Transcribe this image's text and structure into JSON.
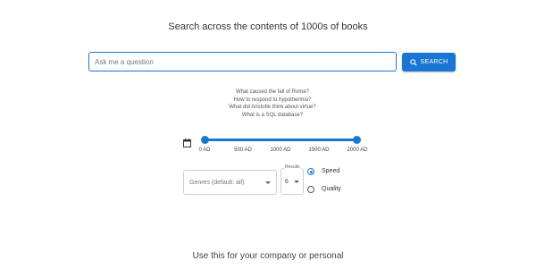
{
  "header": {
    "title": "Search across the contents of 1000s of books"
  },
  "search": {
    "placeholder": "Ask me a question",
    "button_label": "SEARCH"
  },
  "suggestions": [
    "What caused the fall of Rome?",
    "How to respond to hypothermia?",
    "What did Aristotle think about virtue?",
    "What is a SQL database?"
  ],
  "date_range": {
    "icon": "calendar-icon",
    "ticks": [
      "0 AD",
      "500 AD",
      "1000 AD",
      "1500 AD",
      "2000 AD"
    ],
    "min": "0 AD",
    "max": "2000 AD"
  },
  "filters": {
    "genres_placeholder": "Genres (default: all)",
    "results_label": "Results",
    "results_value": "6"
  },
  "ranking": {
    "options": [
      {
        "label": "Speed",
        "selected": true
      },
      {
        "label": "Quality",
        "selected": false
      }
    ]
  },
  "footer": {
    "text": "Use this for your company or personal"
  },
  "colors": {
    "accent": "#1976d2"
  }
}
